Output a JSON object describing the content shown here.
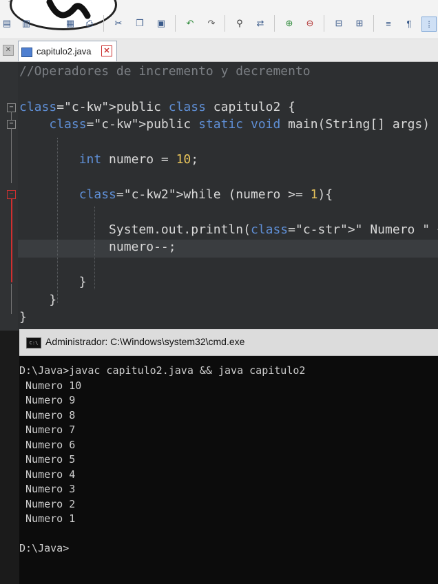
{
  "toolbar": {
    "help_mark": "?",
    "icons": [
      "save-icon",
      "save-all-icon",
      "print-preview-icon",
      "print-icon",
      "cut-icon",
      "copy-icon",
      "paste-icon",
      "undo-icon",
      "redo-icon",
      "find-icon",
      "replace-icon",
      "zoom-in-icon",
      "zoom-out-icon",
      "sync-scroll-v-icon",
      "sync-scroll-h-icon",
      "wrap-icon",
      "show-chars-icon",
      "indent-guide-icon"
    ]
  },
  "tabs": [
    {
      "label": "capitulo2.java",
      "close": "✕"
    }
  ],
  "editor": {
    "lines": [
      {
        "text": "//Operadores de incremento y decremento"
      },
      {
        "text": "public class capitulo2 {"
      },
      {
        "text": "    public static void main(String[] args) {"
      },
      {
        "text": "        int numero = 10;"
      },
      {
        "text": "        while (numero >= 1){"
      },
      {
        "text": "            System.out.println(\" Numero \" + nu"
      },
      {
        "text": "            numero--;"
      },
      {
        "text": "        }"
      },
      {
        "text": "    }"
      },
      {
        "text": "}"
      }
    ]
  },
  "console": {
    "title": "Administrador: C:\\Windows\\system32\\cmd.exe",
    "icon_label": "C:\\",
    "lines": [
      "D:\\Java>javac capitulo2.java && java capitulo2",
      " Numero 10",
      " Numero 9",
      " Numero 8",
      " Numero 7",
      " Numero 6",
      " Numero 5",
      " Numero 4",
      " Numero 3",
      " Numero 2",
      " Numero 1",
      "",
      "D:\\Java>"
    ]
  }
}
